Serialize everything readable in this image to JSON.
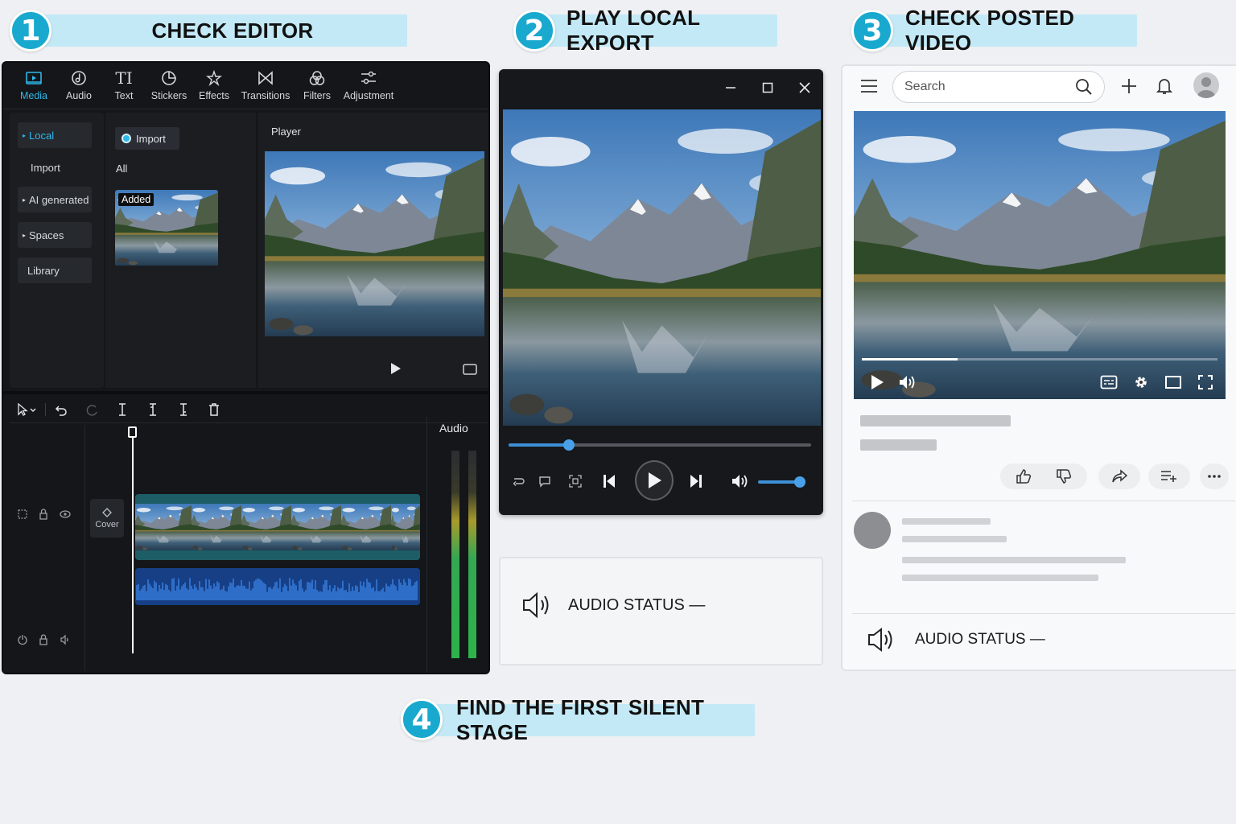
{
  "steps": [
    {
      "number": "1",
      "title": "CHECK EDITOR"
    },
    {
      "number": "2",
      "title": "PLAY LOCAL EXPORT"
    },
    {
      "number": "3",
      "title": "CHECK POSTED VIDEO"
    },
    {
      "number": "4",
      "title": "FIND THE FIRST SILENT STAGE"
    }
  ],
  "editor": {
    "toolbar": [
      {
        "label": "Media",
        "icon": "media-icon",
        "active": true
      },
      {
        "label": "Audio",
        "icon": "audio-icon"
      },
      {
        "label": "Text",
        "icon": "text-icon",
        "glyph": "TI"
      },
      {
        "label": "Stickers",
        "icon": "sticker-icon"
      },
      {
        "label": "Effects",
        "icon": "effects-icon"
      },
      {
        "label": "Transitions",
        "icon": "transitions-icon"
      },
      {
        "label": "Filters",
        "icon": "filters-icon"
      },
      {
        "label": "Adjustment",
        "icon": "adjustment-icon"
      }
    ],
    "sidebar": [
      {
        "label": "Local",
        "active": true,
        "expandable": true
      },
      {
        "label": "Import",
        "expandable": false
      },
      {
        "label": "AI generated",
        "expandable": true
      },
      {
        "label": "Spaces",
        "expandable": true
      },
      {
        "label": "Library",
        "expandable": false
      }
    ],
    "media": {
      "import_label": "Import",
      "filter_label": "All",
      "clip_badge": "Added"
    },
    "player": {
      "label": "Player"
    },
    "timeline": {
      "cover_label": "Cover",
      "audio_label": "Audio"
    },
    "accent": "#2fb8ea"
  },
  "local_player": {
    "progress": 0.2,
    "volume": 1.0,
    "audio_status_label": "AUDIO STATUS —"
  },
  "video_site": {
    "search_placeholder": "Search",
    "progress": 0.27,
    "audio_status_label": "AUDIO STATUS —"
  },
  "colors": {
    "step_badge": "#19a9cf",
    "step_banner": "#c3e9f6",
    "player_accent": "#3e8fd6"
  }
}
